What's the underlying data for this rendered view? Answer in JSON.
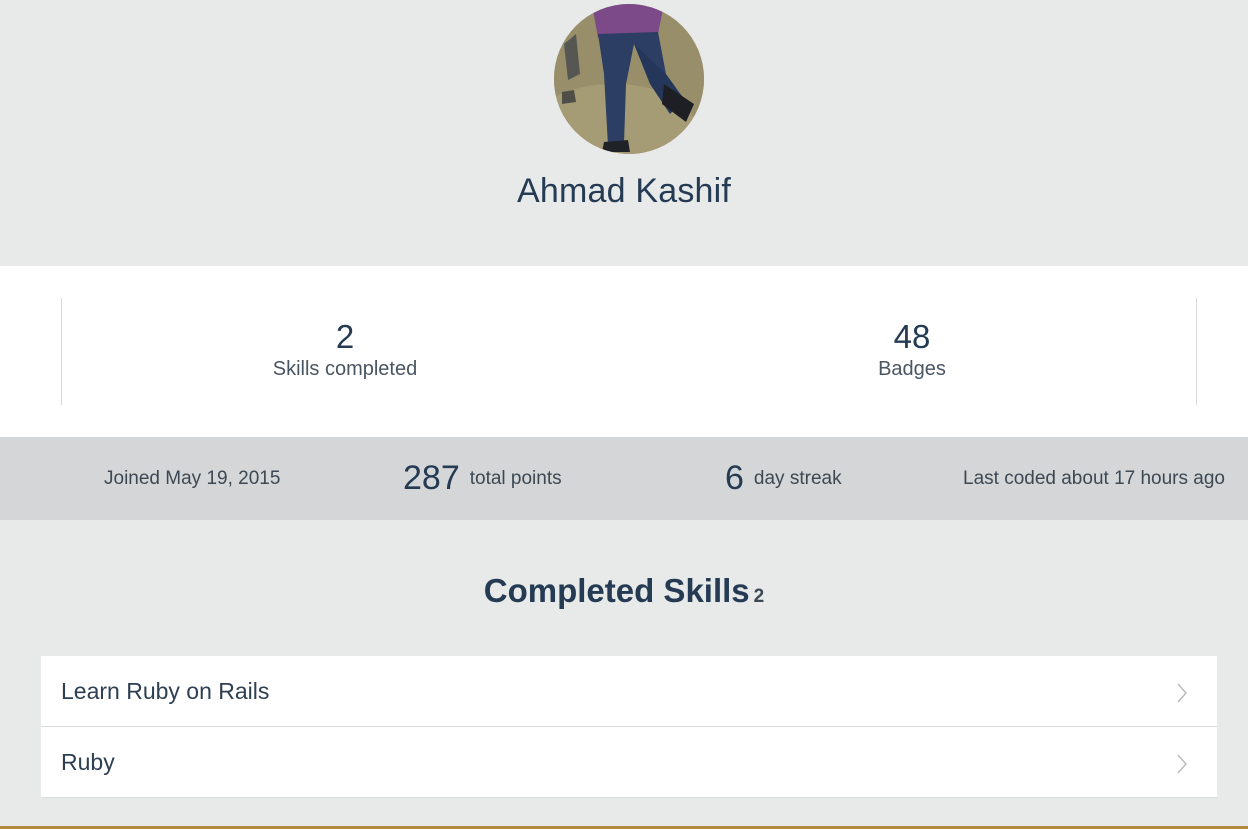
{
  "profile": {
    "name": "Ahmad Kashif"
  },
  "stats": {
    "skills_count": "2",
    "skills_label": "Skills completed",
    "badges_count": "48",
    "badges_label": "Badges"
  },
  "summary": {
    "joined": "Joined May 19, 2015",
    "points_value": "287",
    "points_label": "total points",
    "streak_value": "6",
    "streak_label": "day streak",
    "last_coded": "Last coded about 17 hours ago"
  },
  "completed": {
    "title": "Completed Skills",
    "count": "2",
    "items": [
      {
        "label": "Learn Ruby on Rails",
        "icon": "chevron-right-icon"
      },
      {
        "label": "Ruby",
        "icon": "chevron-right-icon"
      }
    ]
  },
  "colors": {
    "page_bg": "#e8e9e9",
    "stats_bg": "#ffffff",
    "summary_bar_bg": "#d4d6d8",
    "text_dark": "#243b53",
    "accent_bottom": "#b48a3c"
  }
}
